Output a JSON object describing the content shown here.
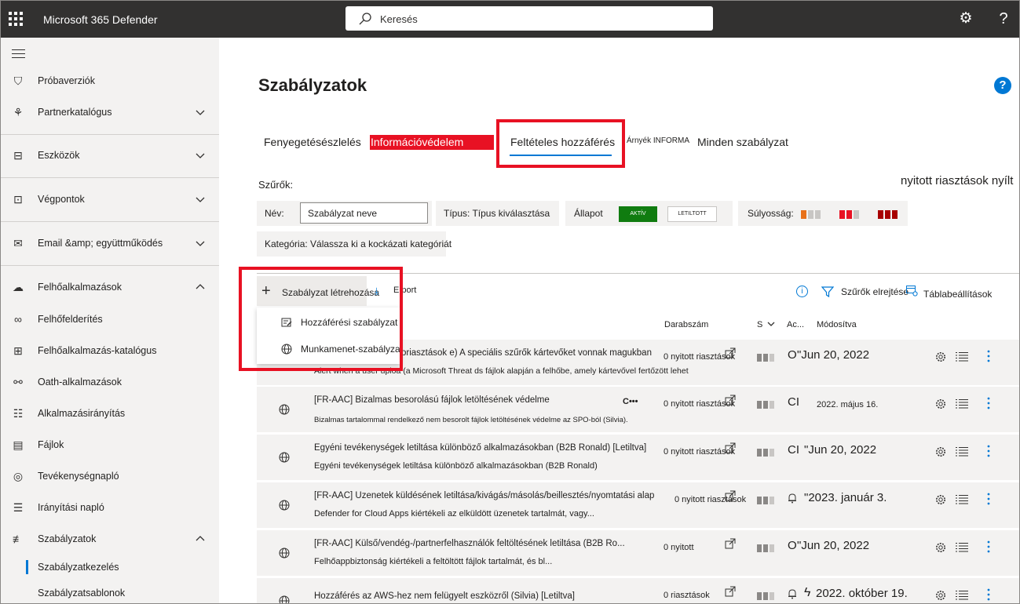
{
  "app": {
    "title": "Microsoft 365 Defender"
  },
  "search": {
    "placeholder": "Keresés"
  },
  "sidebar": {
    "items": [
      {
        "label": "Próbaverziók",
        "icon": "trial-icon"
      },
      {
        "label": "Partnerkatalógus",
        "icon": "partner-icon"
      },
      {
        "label": "Eszközök",
        "icon": "assets-icon"
      },
      {
        "label": "Végpontok",
        "icon": "endpoints-icon"
      },
      {
        "label": "Email &amp; együttműködés",
        "icon": "mail-icon"
      },
      {
        "label": "Felhőalkalmazások",
        "icon": "cloud-icon"
      },
      {
        "label": "Felhőfelderítés",
        "icon": "binoculars-icon"
      },
      {
        "label": "Felhőalkalmazás-katalógus",
        "icon": "catalog-icon"
      },
      {
        "label": "Oath-alkalmazások",
        "icon": "oauth-icon"
      },
      {
        "label": "Alkalmazásirányítás",
        "icon": "governance-icon"
      },
      {
        "label": "Fájlok",
        "icon": "files-icon"
      },
      {
        "label": "Tevékenységnapló",
        "icon": "glasses-icon"
      },
      {
        "label": "Irányítási napló",
        "icon": "clipboard-icon"
      },
      {
        "label": "Szabályzatok",
        "icon": "sliders-icon"
      }
    ],
    "sub_items": [
      {
        "label": "Szabályzatkezelés"
      },
      {
        "label": "Szabályzatsablonok"
      }
    ]
  },
  "page": {
    "title": "Szabályzatok"
  },
  "tabs": {
    "threat": "Fenyegetésészlelés",
    "info": "Információvédelem",
    "conditional": "Feltételes hozzáférés",
    "shadow": "Árnyék INFORMA",
    "all": "Minden szabályzat"
  },
  "filters": {
    "label": "Szűrők:",
    "open_alerts": "nyitott riasztások nyílt",
    "name_label": "Név:",
    "name_value": "Szabályzat neve",
    "type_label": "Típus: Típus kiválasztása",
    "status_label": "Állapot",
    "status_active": "AKTÍV",
    "status_disabled": "LETILTOTT",
    "severity_label": "Súlyosság:",
    "category_label": "Kategória: Válassza ki a kockázati kategóriát"
  },
  "toolbar": {
    "create": "Szabályzat létrehozása",
    "export": "E port",
    "hide_filters": "Szűrők elrejtése",
    "table_settings": "Táblabeállítások"
  },
  "create_menu": {
    "access": "Hozzáférési szabályzat",
    "session": "Munkamenet-szabályzat"
  },
  "table": {
    "headers": {
      "count": "Darabszám",
      "severity": "S",
      "action": "Ac...",
      "modified": "Módosítva"
    },
    "rows": [
      {
        "title": "oriasztások e) A speciális szűrők kártevőket vonnak magukban",
        "desc": "Alert when a user uploa (a Microsoft Threat ds fájlok alapján a felhőbe, amely kártevővel fertőzött lehet",
        "count": "0 nyitott riasztások",
        "action": "O",
        "modified": "\"Jun 20, 2022"
      },
      {
        "title": "[FR-AAC] Bizalmas besorolású fájlok letöltésének védelme",
        "extra": "C•••",
        "desc": "Bizalmas tartalommal rendelkező nem besorolt fájlok letöltésének védelme az SPO-ból (Silvia).",
        "count": "0 nyitott riasztások",
        "action": "CI",
        "modified": "2022. május 16."
      },
      {
        "title": "Egyéni tevékenységek letiltása különböző alkalmazásokban (B2B Ronald) [Letiltva]",
        "desc": "Egyéni tevékenységek letiltása különböző alkalmazásokban (B2B Ronald)",
        "count": "0 nyitott riasztások",
        "action": "CI",
        "modified": "\"Jun 20, 2022"
      },
      {
        "title": "[FR-AAC] Üzenetek küldésének letiltása/kivágás/másolás/beillesztés/nyomtatási alap",
        "desc": "Defender for Cloud Apps kiértékeli az elküldött üzenetek tartalmát, vagy...",
        "count": "0 nyitott riasztások",
        "action": "",
        "modified": "\"2023. január 3."
      },
      {
        "title": "[FR-AAC] Külső/vendég-/partnerfelhasználók feltöltésének letiltása (B2B Ro...",
        "desc": "Felhőappbiztonság kiértékeli a feltöltött fájlok tartalmát, és bl...",
        "count": "0 nyitott",
        "action": "O",
        "modified": "\"Jun 20, 2022"
      },
      {
        "title": "Hozzáférés az AWS-hez nem felügyelt eszközről (Silvia) [Letiltva]",
        "desc": "",
        "count": "0 riasztások",
        "action": "",
        "modified": "2022. október 19."
      }
    ]
  },
  "colors": {
    "topbar": "#323130",
    "accent": "#0078d4",
    "highlight_red": "#e81123",
    "status_active": "#107c10",
    "sev_low": "#e8711a",
    "sev_medium": "#e81123",
    "sev_high": "#a80000"
  }
}
